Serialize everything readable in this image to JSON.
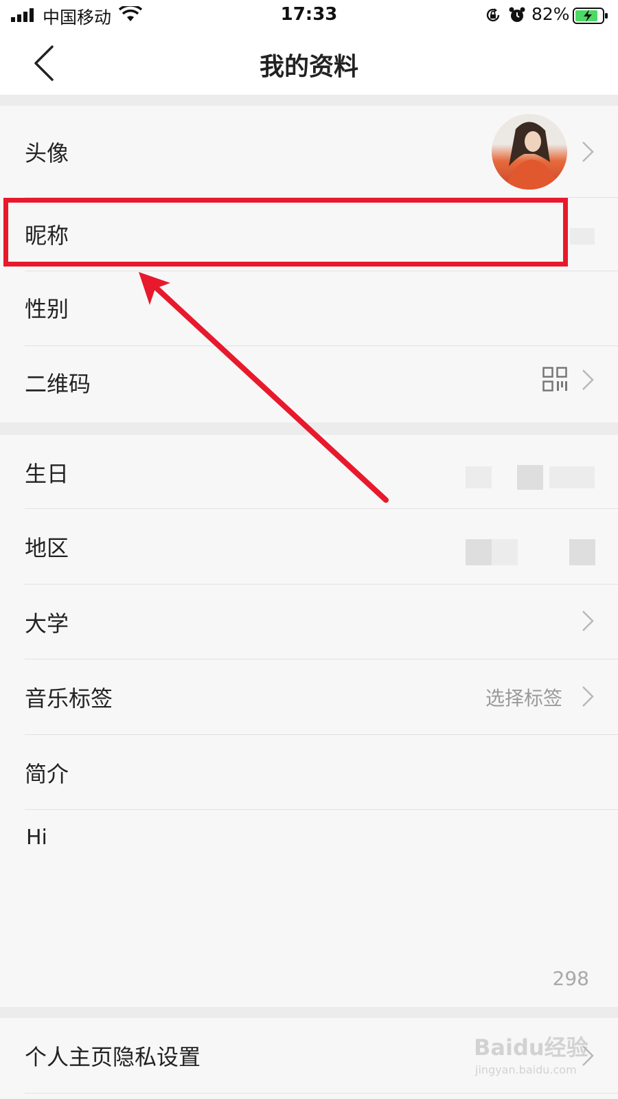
{
  "status_bar": {
    "carrier": "中国移动",
    "time": "17:33",
    "battery": "82%"
  },
  "nav": {
    "title": "我的资料"
  },
  "section1": {
    "rows": [
      {
        "label": "头像"
      },
      {
        "label": "昵称"
      },
      {
        "label": "性别"
      },
      {
        "label": "二维码"
      }
    ]
  },
  "section2": {
    "rows": [
      {
        "label": "生日"
      },
      {
        "label": "地区"
      },
      {
        "label": "大学"
      },
      {
        "label": "音乐标签",
        "value": "选择标签"
      },
      {
        "label": "简介"
      }
    ],
    "intro_text": "Hi",
    "char_count": "298"
  },
  "section3": {
    "rows": [
      {
        "label": "个人主页隐私设置"
      }
    ]
  },
  "watermark": {
    "text": "Baidu经验",
    "sub": "jingyan.baidu.com"
  },
  "colors": {
    "annotation": "#e8192c",
    "background": "#f7f7f7",
    "label_text": "#222222",
    "secondary_text": "#9a9a9a"
  }
}
